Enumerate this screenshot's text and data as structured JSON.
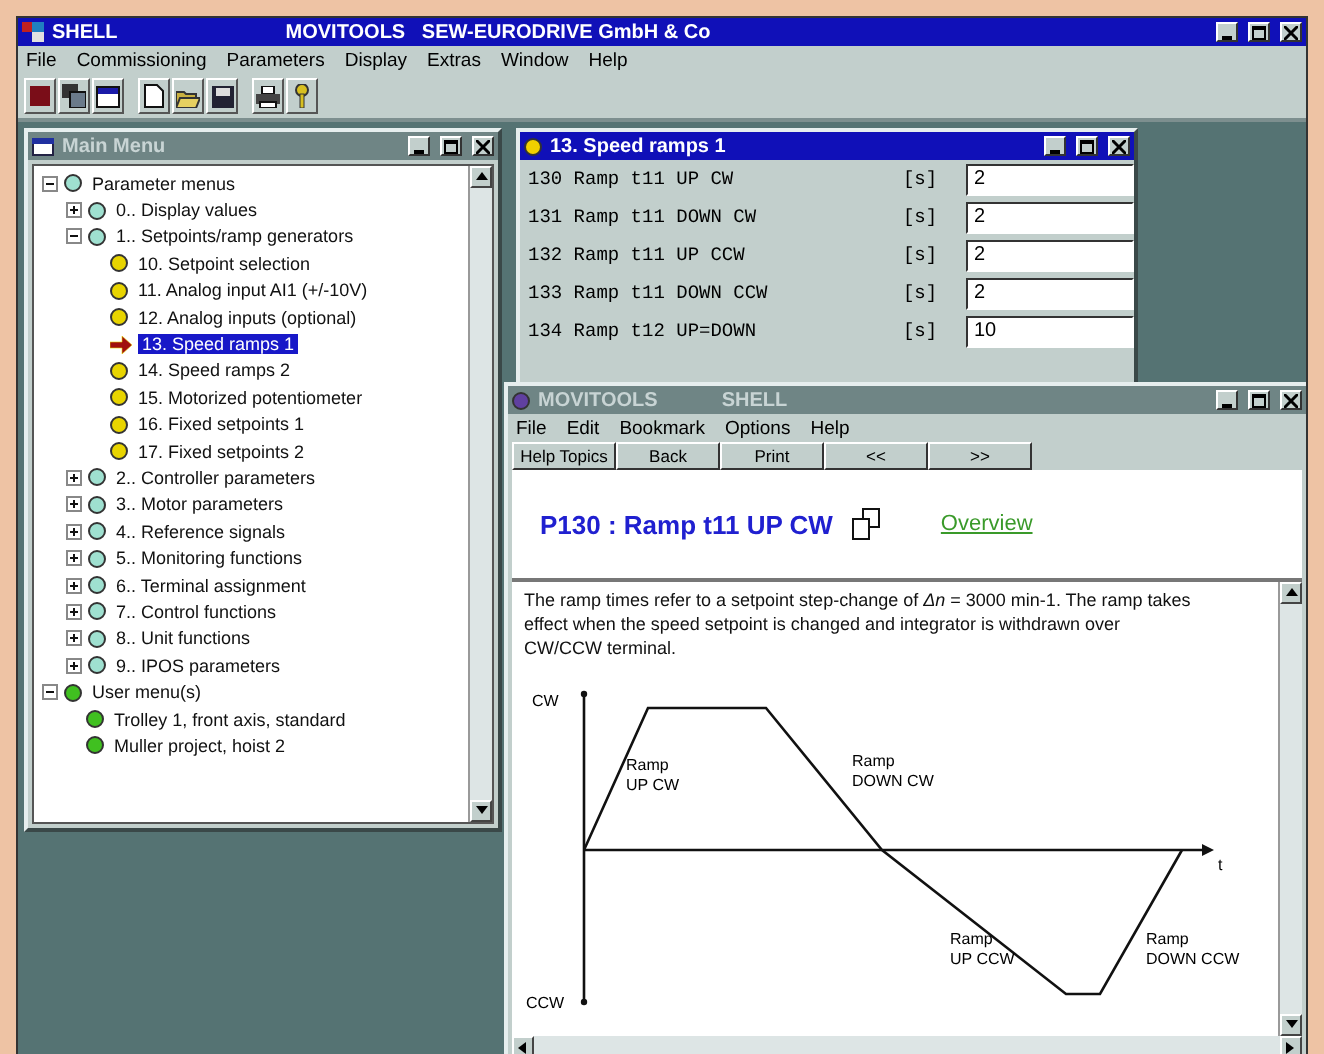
{
  "window": {
    "title": "SHELL",
    "subtitle": "MOVITOOLS   SEW-EURODRIVE GmbH & Co"
  },
  "menu": [
    "File",
    "Commissioning",
    "Parameters",
    "Display",
    "Extras",
    "Window",
    "Help"
  ],
  "toolbar": [
    {
      "kind": "stop"
    },
    {
      "kind": "windows"
    },
    {
      "kind": "window"
    },
    {
      "kind": "sep"
    },
    {
      "kind": "new"
    },
    {
      "kind": "open"
    },
    {
      "kind": "save"
    },
    {
      "kind": "sep"
    },
    {
      "kind": "print"
    },
    {
      "kind": "key"
    }
  ],
  "main_menu": {
    "title": "Main Menu",
    "tree": [
      {
        "label": "Parameter menus",
        "kind": "group",
        "expanded": true,
        "children": [
          {
            "label": "0.. Display values",
            "kind": "group",
            "expanded": false
          },
          {
            "label": "1.. Setpoints/ramp generators",
            "kind": "group",
            "expanded": true,
            "children": [
              {
                "label": "10. Setpoint selection",
                "kind": "param",
                "selected": false
              },
              {
                "label": "11. Analog input AI1 (+/-10V)",
                "kind": "param",
                "selected": false
              },
              {
                "label": "12. Analog inputs (optional)",
                "kind": "param",
                "selected": false
              },
              {
                "label": "13. Speed ramps 1",
                "kind": "param",
                "selected": true
              },
              {
                "label": "14. Speed ramps 2",
                "kind": "param",
                "selected": false
              },
              {
                "label": "15. Motorized potentiometer",
                "kind": "param",
                "selected": false
              },
              {
                "label": "16. Fixed setpoints 1",
                "kind": "param",
                "selected": false
              },
              {
                "label": "17. Fixed setpoints 2",
                "kind": "param",
                "selected": false
              }
            ]
          },
          {
            "label": "2.. Controller parameters",
            "kind": "group",
            "expanded": false
          },
          {
            "label": "3.. Motor parameters",
            "kind": "group",
            "expanded": false
          },
          {
            "label": "4.. Reference signals",
            "kind": "group",
            "expanded": false
          },
          {
            "label": "5.. Monitoring functions",
            "kind": "group",
            "expanded": false
          },
          {
            "label": "6.. Terminal assignment",
            "kind": "group",
            "expanded": false
          },
          {
            "label": "7.. Control functions",
            "kind": "group",
            "expanded": false
          },
          {
            "label": "8.. Unit functions",
            "kind": "group",
            "expanded": false
          },
          {
            "label": "9.. IPOS parameters",
            "kind": "group",
            "expanded": false
          }
        ]
      },
      {
        "label": "User menu(s)",
        "kind": "user",
        "expanded": true,
        "children": [
          {
            "label": "Trolley 1, front axis, standard",
            "kind": "user",
            "selected": false
          },
          {
            "label": "Muller project, hoist 2",
            "kind": "user",
            "selected": false
          }
        ]
      }
    ]
  },
  "speed_ramps": {
    "title": "13. Speed ramps 1",
    "rows": [
      {
        "label": "130 Ramp t11 UP CW",
        "unit": "[s]",
        "value": "2"
      },
      {
        "label": "131 Ramp t11 DOWN CW",
        "unit": "[s]",
        "value": "2"
      },
      {
        "label": "132 Ramp t11 UP CCW",
        "unit": "[s]",
        "value": "2"
      },
      {
        "label": "133 Ramp t11 DOWN CCW",
        "unit": "[s]",
        "value": "2"
      },
      {
        "label": "134 Ramp t12 UP=DOWN",
        "unit": "[s]",
        "value": "10"
      }
    ]
  },
  "help": {
    "title": "MOVITOOLS",
    "title_2": "SHELL",
    "menu": [
      "File",
      "Edit",
      "Bookmark",
      "Options",
      "Help"
    ],
    "buttons": [
      "Help Topics",
      "Back",
      "Print",
      "<<",
      ">>"
    ],
    "heading": "P130 : Ramp t11 UP CW",
    "link": "Overview",
    "text": "The ramp times refer to a setpoint step-change of *Δn* = 3000 min-1. The ramp takes effect when the speed setpoint is changed and integrator is withdrawn over CW/CCW terminal.",
    "diagram": {
      "axis_top": "CW",
      "axis_bottom": "CCW",
      "axis_time": "t",
      "labels": [
        [
          "Ramp",
          "UP CW"
        ],
        [
          "Ramp",
          "DOWN CW"
        ],
        [
          "Ramp",
          "UP CCW"
        ],
        [
          "Ramp",
          "DOWN CCW"
        ]
      ]
    }
  }
}
